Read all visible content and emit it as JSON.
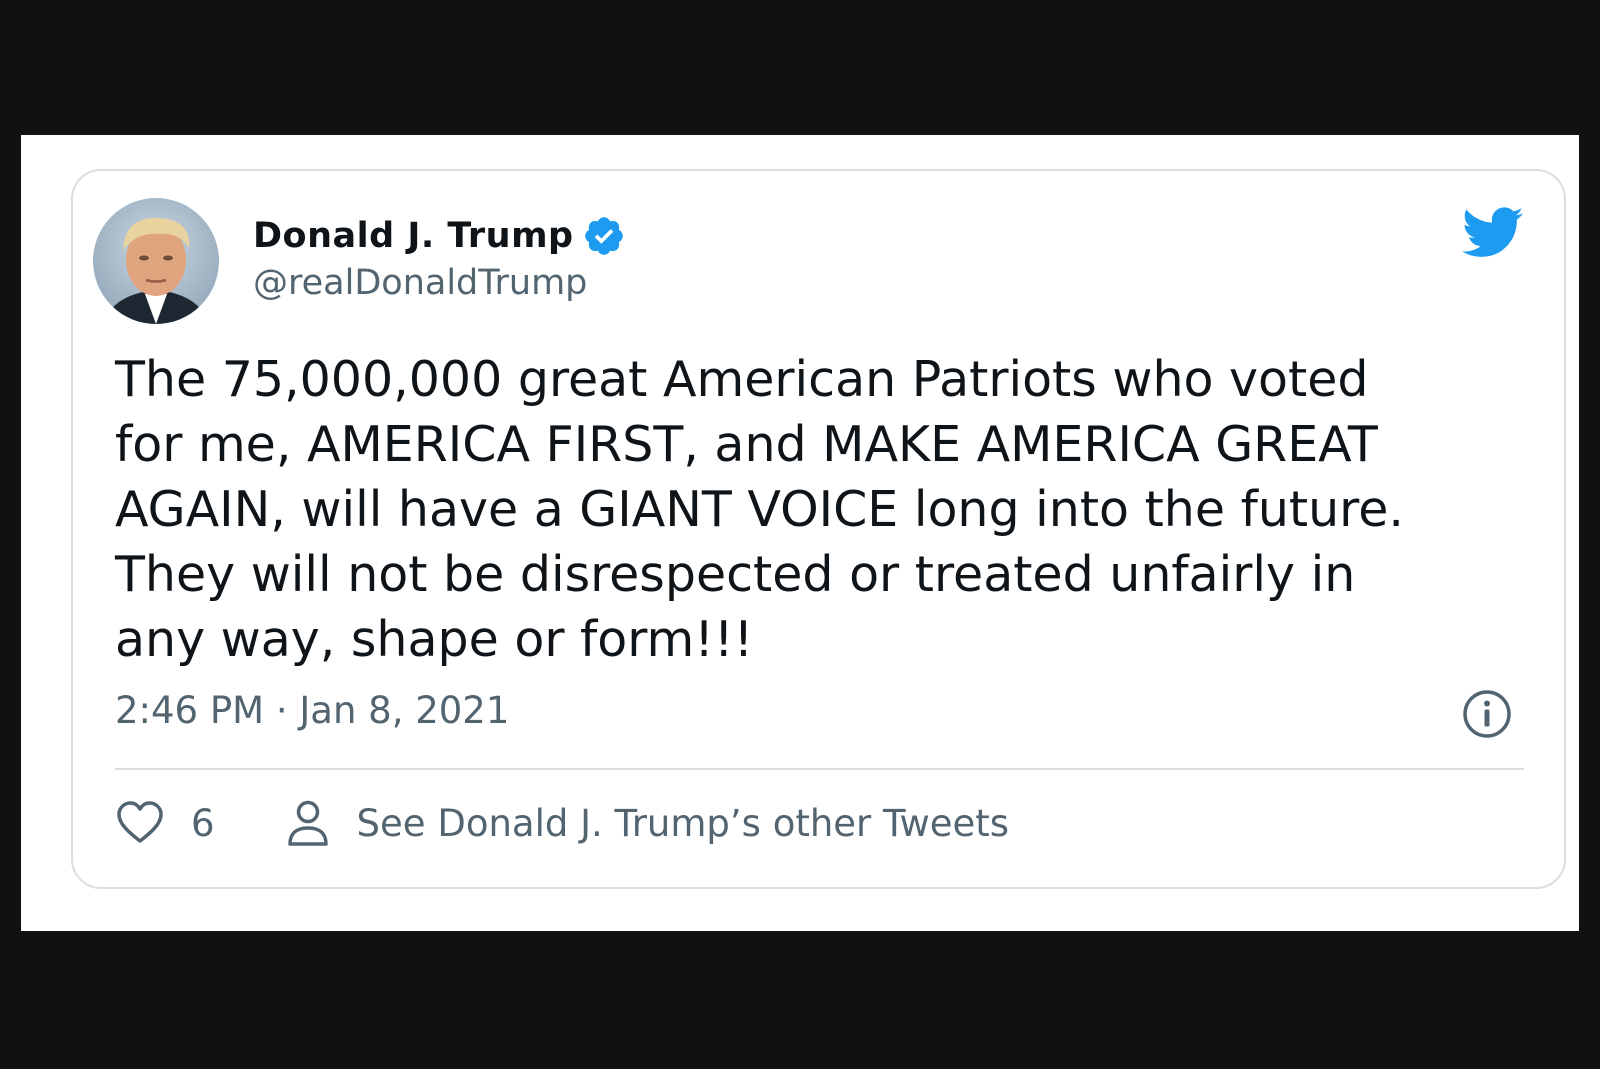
{
  "tweet": {
    "author": {
      "name": "Donald J. Trump",
      "handle": "@realDonaldTrump",
      "verified": true,
      "avatar_icon": "profile-photo"
    },
    "text": "The 75,000,000 great American Patriots who voted\nfor me, AMERICA FIRST, and MAKE AMERICA GREAT\nAGAIN, will have a GIANT VOICE long into the future.\nThey will not be disrespected or treated unfairly in\nany way, shape or form!!!",
    "timestamp": "2:46 PM · Jan 8, 2021",
    "likes": "6",
    "profile_link_label": "See Donald J. Trump’s other Tweets"
  },
  "icons": {
    "brand": "twitter-bird-icon",
    "verified": "verified-badge-icon",
    "info": "info-icon",
    "like": "heart-icon",
    "profile": "person-icon"
  },
  "colors": {
    "twitter_blue": "#1d9bf0",
    "text_primary": "#0f1419",
    "text_secondary": "#536471",
    "border": "#d9dee3",
    "frame_background": "#111111"
  }
}
